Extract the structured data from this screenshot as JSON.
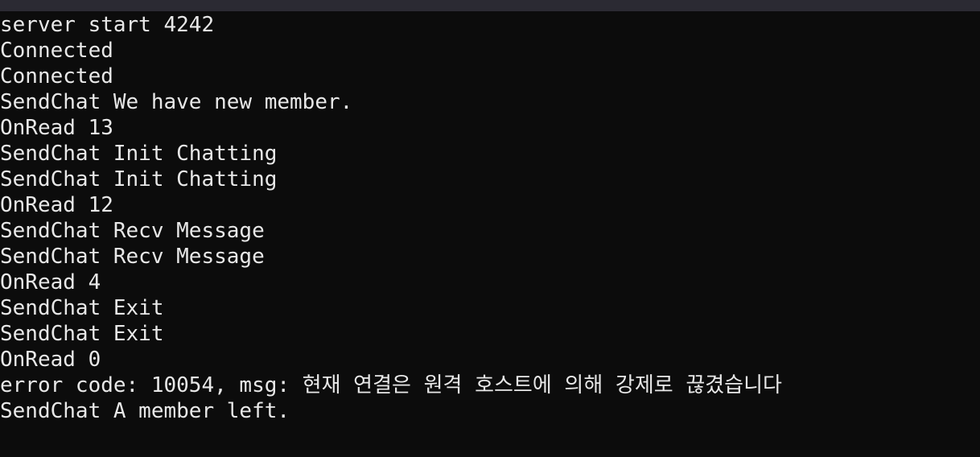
{
  "console": {
    "lines": [
      "server start 4242",
      "Connected",
      "Connected",
      "SendChat We have new member.",
      "OnRead 13",
      "SendChat Init Chatting",
      "SendChat Init Chatting",
      "OnRead 12",
      "SendChat Recv Message",
      "SendChat Recv Message",
      "OnRead 4",
      "SendChat Exit",
      "SendChat Exit",
      "OnRead 0",
      "error code: 10054, msg: 현재 연결은 원격 호스트에 의해 강제로 끊겼습니다",
      "SendChat A member left."
    ]
  },
  "colors": {
    "background": "#0c0c0c",
    "text": "#e8e8e8",
    "title_strip": "#2b2a33"
  }
}
